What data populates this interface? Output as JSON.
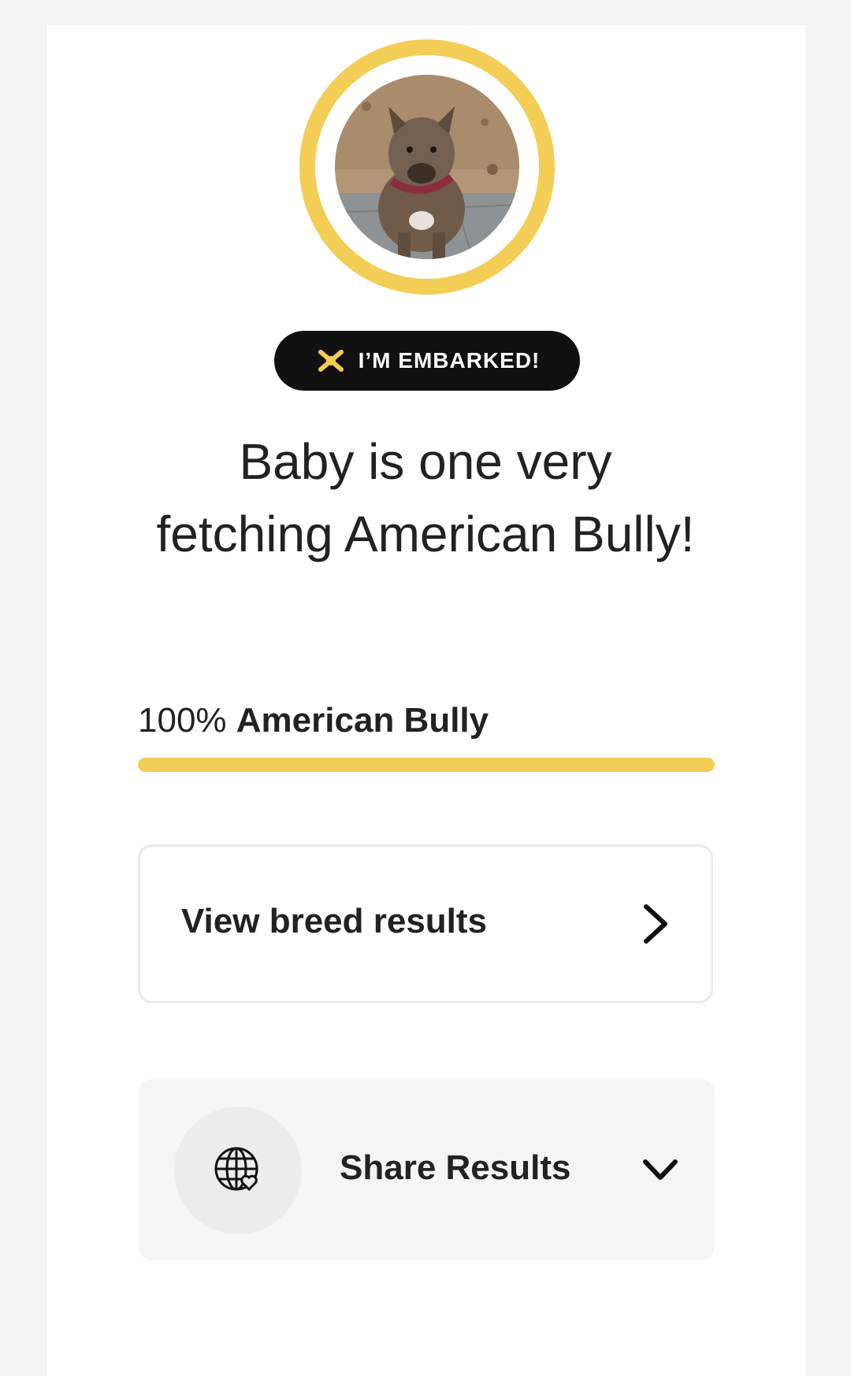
{
  "badge": {
    "label": "I’M EMBARKED!",
    "icon": "bone-star-icon"
  },
  "headline": "Baby is one very fetching American Bully!",
  "breed": {
    "percent": "100%",
    "name": "American Bully",
    "fraction": 1.0
  },
  "results_button": {
    "label": "View breed results",
    "icon": "chevron-right-icon"
  },
  "share": {
    "label": "Share Results",
    "icon": "globe-heart-icon",
    "toggle_icon": "chevron-down-icon"
  },
  "colors": {
    "accent": "#f3cd55",
    "badge_bg": "#111111",
    "text": "#222222"
  }
}
